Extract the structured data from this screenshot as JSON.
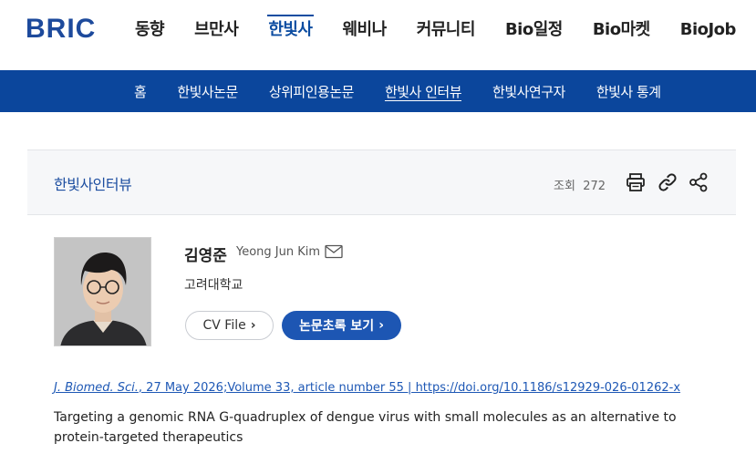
{
  "brand": {
    "logo_text": "BRIC",
    "accent": "#0b469c"
  },
  "main_nav": {
    "items": [
      "동향",
      "브만사",
      "한빛사",
      "웨비나",
      "커뮤니티",
      "Bio일정",
      "Bio마켓",
      "BioJob"
    ],
    "active_index": 2
  },
  "sub_nav": {
    "items": [
      "홈",
      "한빛사논문",
      "상위피인용논문",
      "한빛사 인터뷰",
      "한빛사연구자",
      "한빛사 통계"
    ],
    "active_index": 3
  },
  "content_bar": {
    "title": "한빛사인터뷰",
    "views_label": "조회",
    "views_count": "272",
    "icons": [
      "print-icon",
      "link-icon",
      "share-icon"
    ]
  },
  "profile": {
    "name": "김영준",
    "name_en": "Yeong Jun Kim",
    "affiliation": "고려대학교",
    "cv_button": "CV File",
    "abstract_button": "논문초록 보기"
  },
  "paper": {
    "journal": "J. Biomed. Sci.",
    "citation_rest": ", 27 May 2026;Volume 33, article number 55 | https://doi.org/10.1186/s12929-026-01262-x",
    "title": "Targeting a genomic RNA G-quadruplex of dengue virus with small molecules as an alternative to protein-targeted therapeutics"
  }
}
